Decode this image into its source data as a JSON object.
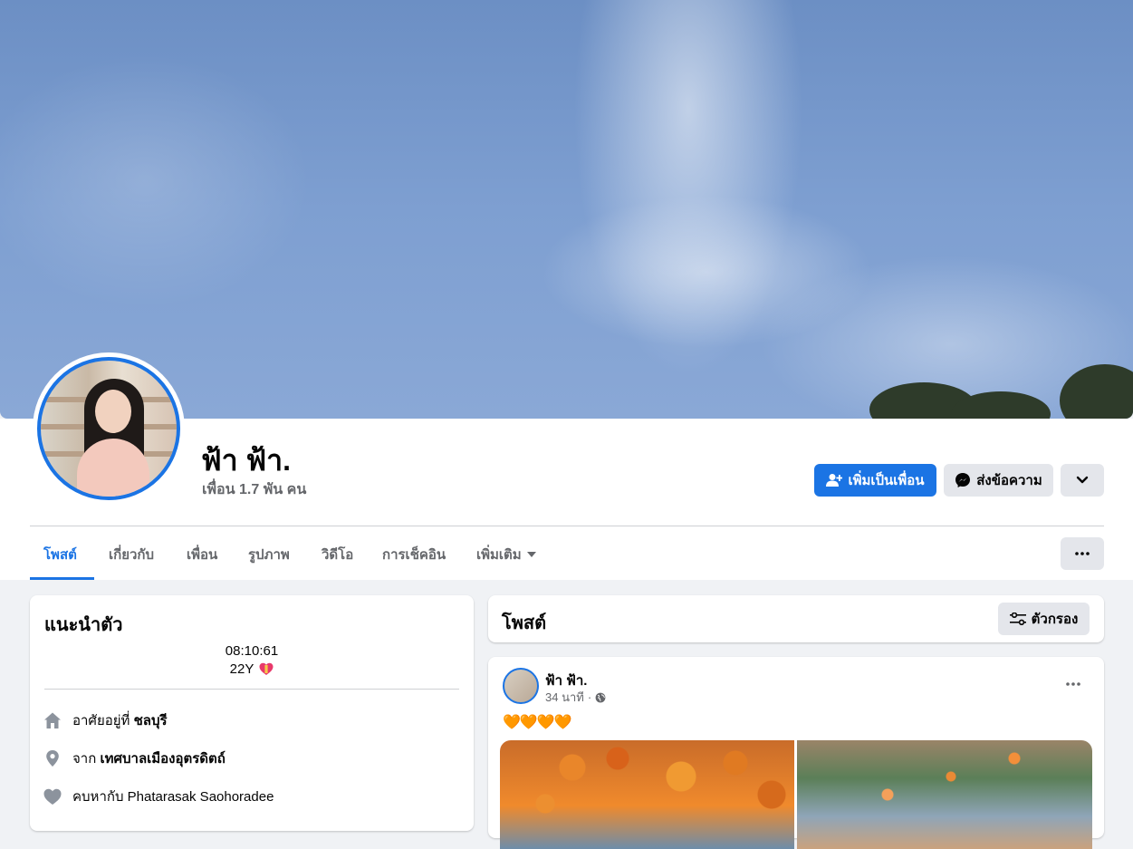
{
  "profile": {
    "name": "ฟ้า ฟ้า.",
    "friends_count": "เพื่อน 1.7 พัน คน"
  },
  "actions": {
    "add_friend": "เพิ่มเป็นเพื่อน",
    "message": "ส่งข้อความ"
  },
  "tabs": [
    {
      "label": "โพสต์",
      "active": true
    },
    {
      "label": "เกี่ยวกับ",
      "active": false
    },
    {
      "label": "เพื่อน",
      "active": false
    },
    {
      "label": "รูปภาพ",
      "active": false
    },
    {
      "label": "วิดีโอ",
      "active": false
    },
    {
      "label": "การเช็คอิน",
      "active": false
    },
    {
      "label": "เพิ่มเติม",
      "active": false
    }
  ],
  "intro": {
    "title": "แนะนำตัว",
    "bio_line1": "08:10:61",
    "bio_line2": "22Y",
    "bio_emoji": "heart-with-ribbon",
    "lives_prefix": "อาศัยอยู่ที่",
    "lives_place": "ชลบุรี",
    "from_prefix": "จาก",
    "from_place": "เทศบาลเมืองอุตรดิตถ์",
    "relationship": "คบหากับ Phatarasak Saohoradee"
  },
  "posts_section": {
    "title": "โพสต์",
    "filter_label": "ตัวกรอง"
  },
  "post": {
    "author": "ฟ้า ฟ้า.",
    "time": "34 นาที",
    "separator": "·",
    "privacy_icon": "globe-icon",
    "text": "🧡🧡🧡🧡"
  },
  "colors": {
    "accent": "#1b74e4",
    "button_gray": "#e4e6eb",
    "secondary_text": "#65676b",
    "page_bg": "#f0f2f5"
  }
}
